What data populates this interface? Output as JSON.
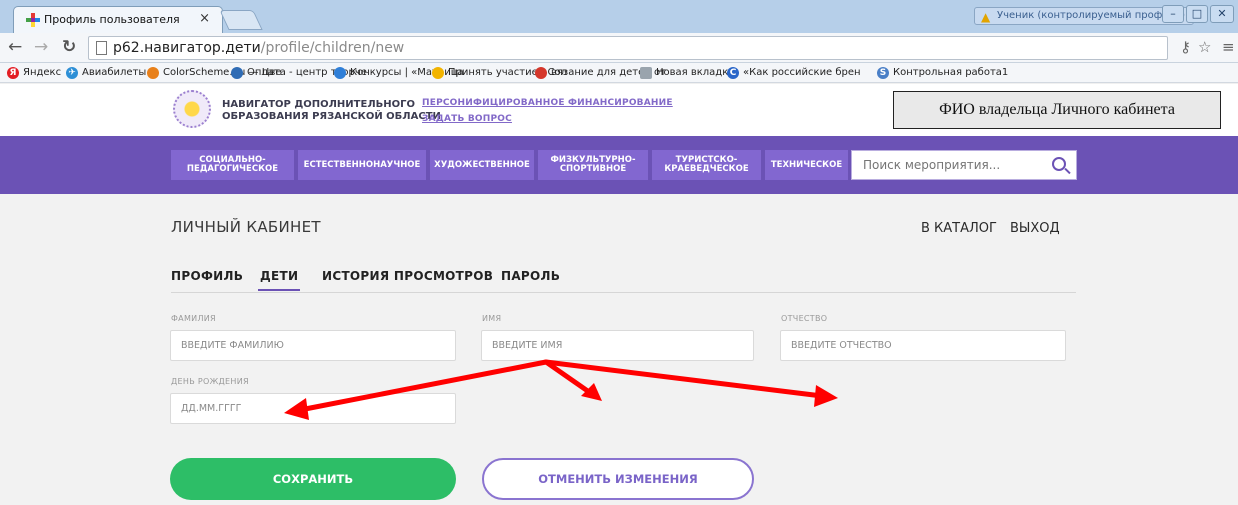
{
  "browser": {
    "tab_title": "Профиль пользователя",
    "tab_close": "×",
    "profile_badge": "Ученик (контролируемый профиль)",
    "url_host": "р62.навигатор.дети",
    "url_path": "/profile/children/new",
    "bookmarks": [
      {
        "label": "Яндекс",
        "icon": "yandex-icon",
        "color": "#e31e24",
        "glyph": "Я"
      },
      {
        "label": "Авиабилеты",
        "icon": "plane-icon",
        "color": "#2d8fd6",
        "glyph": "✈"
      },
      {
        "label": "ColorScheme.Ru — Цве",
        "icon": "colorscheme-icon",
        "color": "#e8801a",
        "glyph": ""
      },
      {
        "label": "Оплата - центр творче",
        "icon": "payment-icon",
        "color": "#2f6cb5",
        "glyph": ""
      },
      {
        "label": "Конкурсы | «Матрица",
        "icon": "contest-icon",
        "color": "#2f7fd8",
        "glyph": ""
      },
      {
        "label": "Принять участие | Сол",
        "icon": "sun-icon",
        "color": "#f2b400",
        "glyph": ""
      },
      {
        "label": "вязание для детей от",
        "icon": "yarn-icon",
        "color": "#d5372b",
        "glyph": ""
      },
      {
        "label": "Новая вкладка",
        "icon": "page-icon",
        "color": "#9aa4ad",
        "glyph": ""
      },
      {
        "label": "«Как российские брен",
        "icon": "c-icon",
        "color": "#2a66c9",
        "glyph": "C"
      },
      {
        "label": "Контрольная работа1",
        "icon": "s-icon",
        "color": "#4a7fc7",
        "glyph": "S"
      }
    ]
  },
  "header": {
    "logo_line1": "НАВИГАТОР ДОПОЛНИТЕЛЬНОГО",
    "logo_line2": "ОБРАЗОВАНИЯ РЯЗАНСКОЙ ОБЛАСТИ",
    "link_financing": "ПЕРСОНИФИЦИРОВАННОЕ ФИНАНСИРОВАНИЕ",
    "link_question": "ЗАДАТЬ ВОПРОС",
    "owner_box": "ФИО владельца Личного кабинета"
  },
  "menu": {
    "categories": [
      {
        "line1": "СОЦИАЛЬНО-",
        "line2": "ПЕДАГОГИЧЕСКОЕ"
      },
      {
        "line1": "ЕСТЕСТВЕННОНАУЧНОЕ",
        "line2": ""
      },
      {
        "line1": "ХУДОЖЕСТВЕННОЕ",
        "line2": ""
      },
      {
        "line1": "ФИЗКУЛЬТУРНО-",
        "line2": "СПОРТИВНОЕ"
      },
      {
        "line1": "ТУРИСТСКО-",
        "line2": "КРАЕВЕДЧЕСКОЕ"
      },
      {
        "line1": "ТЕХНИЧЕСКОЕ",
        "line2": ""
      }
    ],
    "search_placeholder": "Поиск мероприятия..."
  },
  "main": {
    "title": "ЛИЧНЫЙ КАБИНЕТ",
    "to_catalog": "В КАТАЛОГ",
    "logout": "ВЫХОД",
    "tabs": [
      {
        "label": "ПРОФИЛЬ",
        "active": false
      },
      {
        "label": "ДЕТИ",
        "active": true
      },
      {
        "label": "ИСТОРИЯ ПРОСМОТРОВ",
        "active": false
      },
      {
        "label": "ПАРОЛЬ",
        "active": false
      }
    ],
    "fields": {
      "surname_label": "ФАМИЛИЯ",
      "surname_placeholder": "ВВЕДИТЕ ФАМИЛИЮ",
      "name_label": "ИМЯ",
      "name_placeholder": "ВВЕДИТЕ ИМЯ",
      "patronymic_label": "ОТЧЕСТВО",
      "patronymic_placeholder": "ВВЕДИТЕ ОТЧЕСТВО",
      "birthday_label": "ДЕНЬ РОЖДЕНИЯ",
      "birthday_placeholder": "ДД.ММ.ГГГГ"
    },
    "save_label": "СОХРАНИТЬ",
    "cancel_label": "ОТМЕНИТЬ ИЗМЕНЕНИЯ"
  },
  "colors": {
    "menu_purple": "#6b52b5",
    "save_green": "#2dbe67",
    "annotation_red": "#ff0000"
  }
}
